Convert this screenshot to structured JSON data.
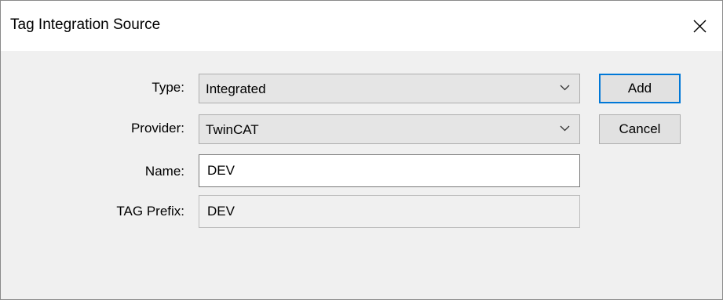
{
  "window": {
    "title": "Tag Integration Source",
    "close_icon": "close-icon"
  },
  "form": {
    "type_label": "Type:",
    "type_value": "Integrated",
    "provider_label": "Provider:",
    "provider_value": "TwinCAT",
    "name_label": "Name:",
    "name_value": "DEV",
    "prefix_label": "TAG Prefix:",
    "prefix_value": "DEV"
  },
  "buttons": {
    "add_label": "Add",
    "cancel_label": "Cancel"
  },
  "colors": {
    "accent": "#0078d7",
    "dialog_background": "#f0f0f0"
  }
}
